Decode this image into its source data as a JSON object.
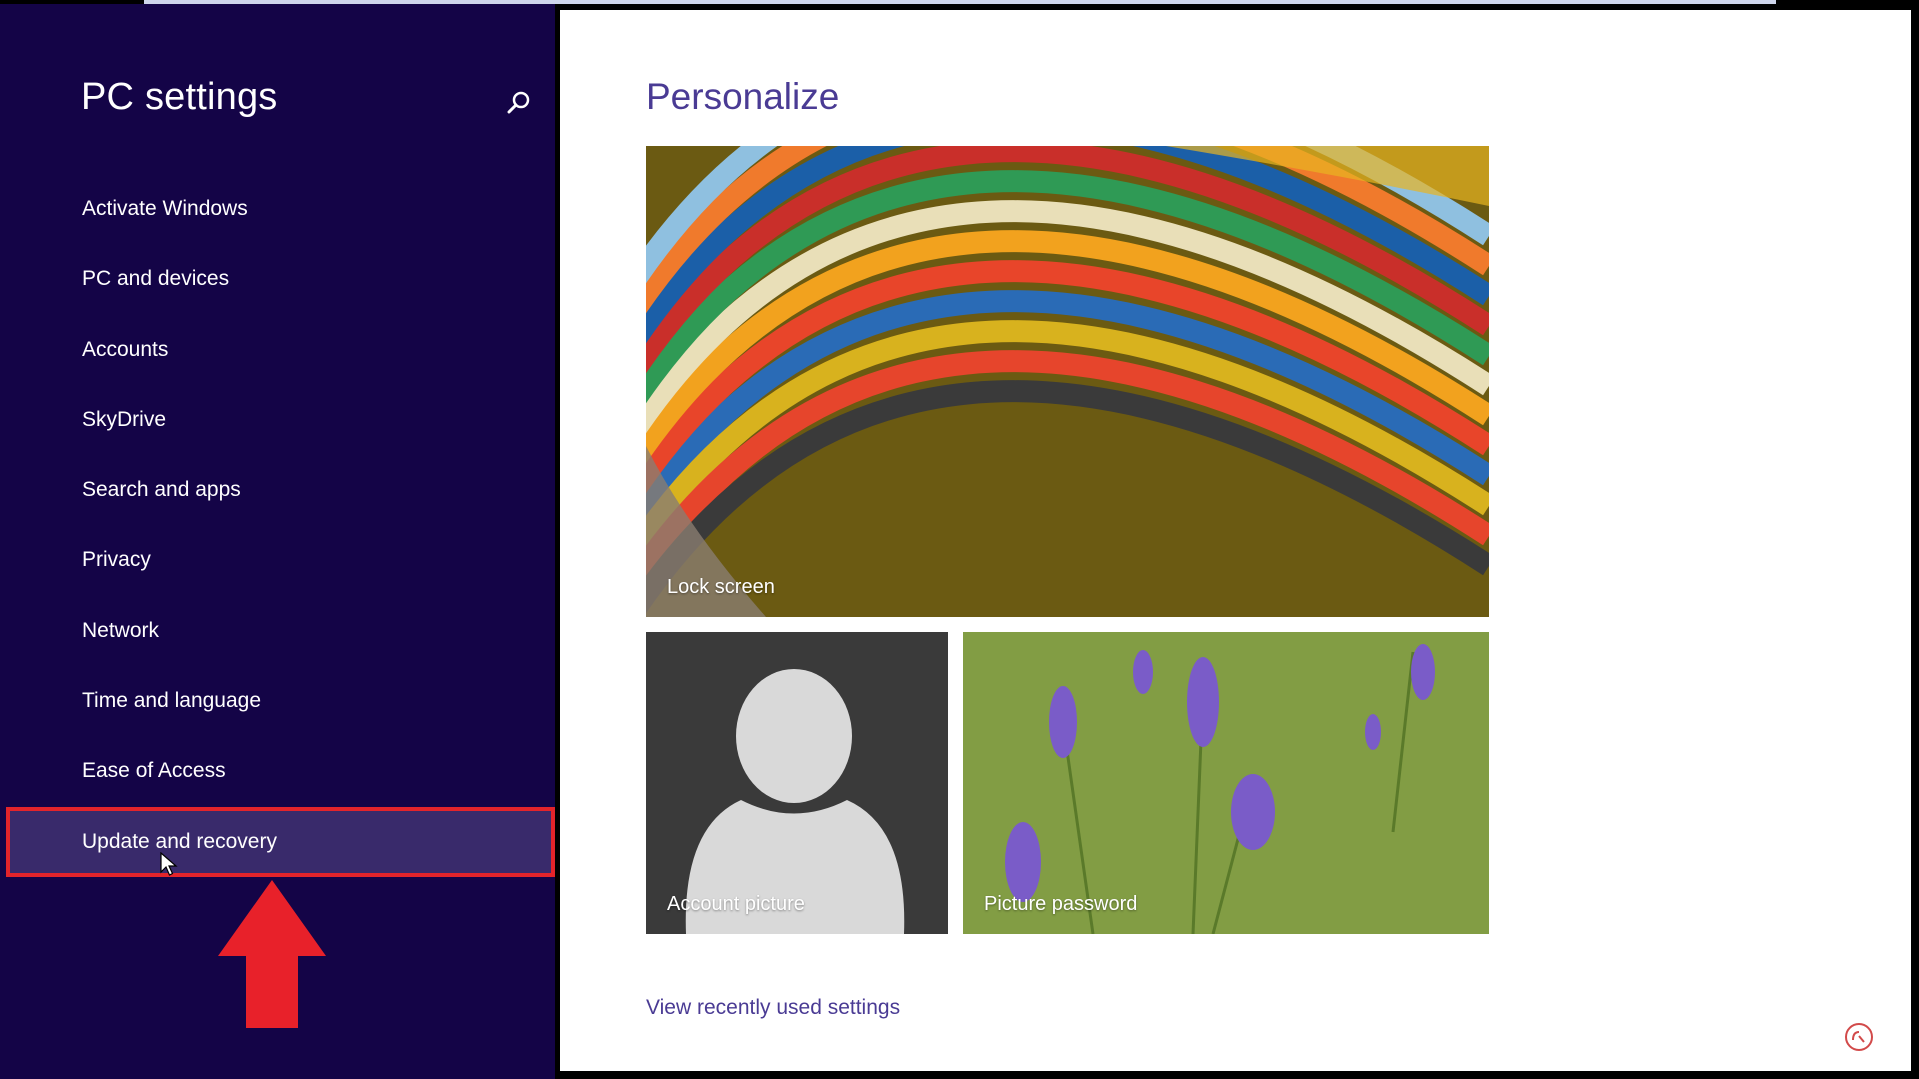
{
  "sidebar": {
    "title": "PC settings",
    "search_icon": "search-icon",
    "items": [
      {
        "label": "Activate Windows"
      },
      {
        "label": "PC and devices"
      },
      {
        "label": "Accounts"
      },
      {
        "label": "SkyDrive"
      },
      {
        "label": "Search and apps"
      },
      {
        "label": "Privacy"
      },
      {
        "label": "Network"
      },
      {
        "label": "Time and language"
      },
      {
        "label": "Ease of Access"
      },
      {
        "label": "Update and recovery",
        "selected": true
      }
    ]
  },
  "main": {
    "title": "Personalize",
    "tiles": {
      "lock_screen": "Lock screen",
      "account_picture": "Account picture",
      "picture_password": "Picture password"
    },
    "recent_link": "View recently used settings"
  },
  "colors": {
    "sidebar_bg": "#140447",
    "selected_bg": "#392a6b",
    "highlight_border": "#e3242b",
    "accent": "#4a3b94"
  }
}
